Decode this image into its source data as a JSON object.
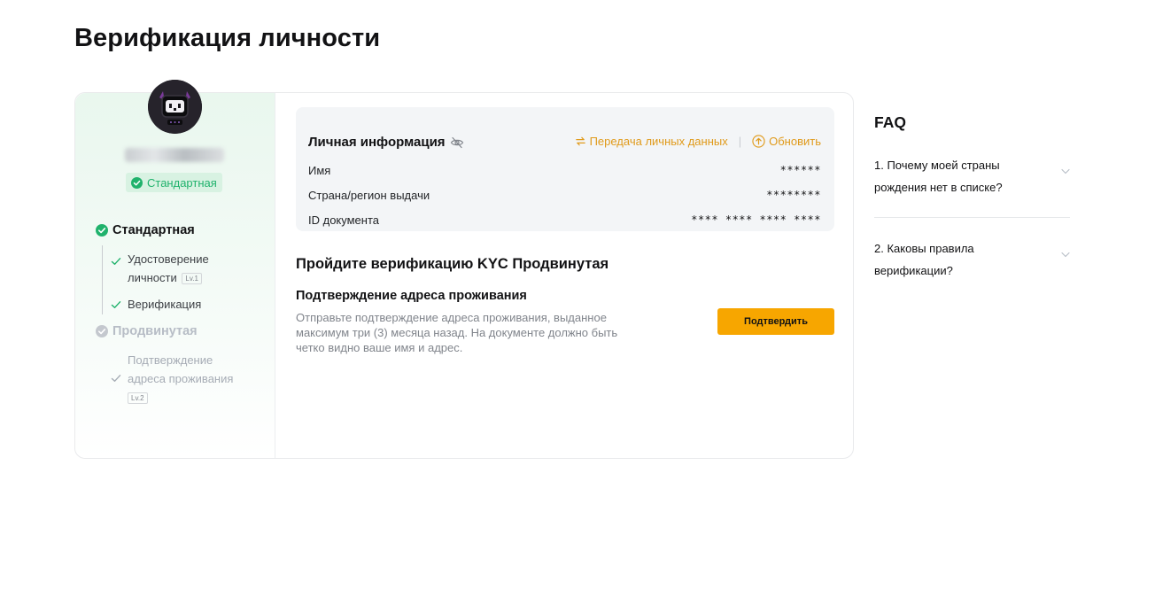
{
  "page": {
    "title": "Верификация личности"
  },
  "profile": {
    "username_blurred": "",
    "level_badge": "Стандартная"
  },
  "steps": {
    "standard": {
      "label": "Стандартная",
      "sub": [
        {
          "label": "Удостоверение личности",
          "tag": "Lv.1"
        },
        {
          "label": "Верификация"
        }
      ]
    },
    "advanced": {
      "label": "Продвинутая",
      "sub": [
        {
          "label": "Подтверждение адреса проживания",
          "tag": "Lv.2"
        }
      ]
    }
  },
  "personal_info": {
    "title": "Личная информация",
    "transfer_label": "Передача личных данных",
    "update_label": "Обновить",
    "rows": [
      {
        "label": "Имя",
        "value": "******"
      },
      {
        "label": "Страна/регион выдачи",
        "value": "********"
      },
      {
        "label": "ID документа",
        "value": "**** **** **** ****"
      }
    ]
  },
  "kyc": {
    "title": "Пройдите верификацию KYC Продвинутая",
    "address_title": "Подтверждение адреса проживания",
    "address_desc": "Отправьте подтверждение адреса проживания, выданное максимум три (3) месяца назад. На документе должно быть четко видно ваше имя и адрес.",
    "confirm_label": "Подтвердить"
  },
  "faq": {
    "title": "FAQ",
    "items": [
      {
        "q": "1. Почему моей страны рождения нет в списке?"
      },
      {
        "q": "2. Каковы правила верификации?"
      }
    ]
  },
  "colors": {
    "accent": "#f7a600",
    "success": "#20b26c",
    "link": "#e09a1a"
  }
}
